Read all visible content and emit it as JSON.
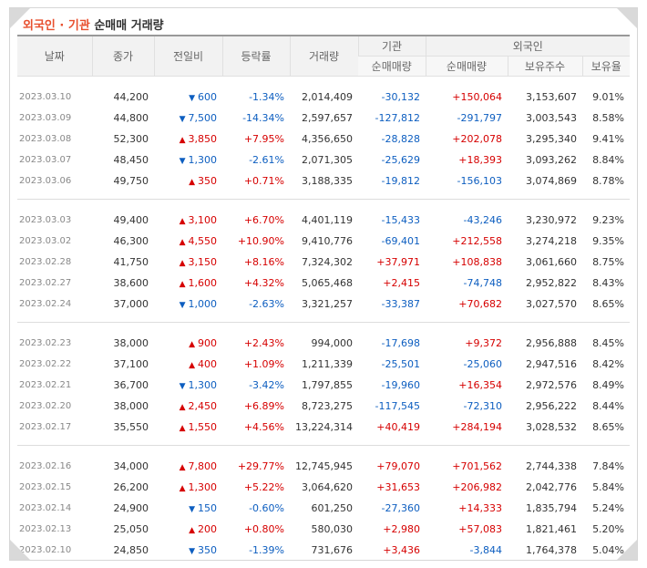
{
  "title": {
    "part1": "외국인 · 기관",
    "part2": "순매매 거래량"
  },
  "headers": {
    "date": "날짜",
    "close": "종가",
    "change": "전일비",
    "rate": "등락률",
    "volume": "거래량",
    "inst": "기관",
    "foreign": "외국인",
    "inst_net": "순매매량",
    "foreign_net": "순매매량",
    "foreign_hold": "보유주수",
    "foreign_ratio": "보유율"
  },
  "groups": [
    [
      {
        "date": "2023.03.10",
        "close": "44,200",
        "dir": "down",
        "change": "600",
        "rate": "-1.34%",
        "volume": "2,014,409",
        "inst": "-30,132",
        "foreign": "+150,064",
        "hold": "3,153,607",
        "ratio": "9.01%"
      },
      {
        "date": "2023.03.09",
        "close": "44,800",
        "dir": "down",
        "change": "7,500",
        "rate": "-14.34%",
        "volume": "2,597,657",
        "inst": "-127,812",
        "foreign": "-291,797",
        "hold": "3,003,543",
        "ratio": "8.58%"
      },
      {
        "date": "2023.03.08",
        "close": "52,300",
        "dir": "up",
        "change": "3,850",
        "rate": "+7.95%",
        "volume": "4,356,650",
        "inst": "-28,828",
        "foreign": "+202,078",
        "hold": "3,295,340",
        "ratio": "9.41%"
      },
      {
        "date": "2023.03.07",
        "close": "48,450",
        "dir": "down",
        "change": "1,300",
        "rate": "-2.61%",
        "volume": "2,071,305",
        "inst": "-25,629",
        "foreign": "+18,393",
        "hold": "3,093,262",
        "ratio": "8.84%"
      },
      {
        "date": "2023.03.06",
        "close": "49,750",
        "dir": "up",
        "change": "350",
        "rate": "+0.71%",
        "volume": "3,188,335",
        "inst": "-19,812",
        "foreign": "-156,103",
        "hold": "3,074,869",
        "ratio": "8.78%"
      }
    ],
    [
      {
        "date": "2023.03.03",
        "close": "49,400",
        "dir": "up",
        "change": "3,100",
        "rate": "+6.70%",
        "volume": "4,401,119",
        "inst": "-15,433",
        "foreign": "-43,246",
        "hold": "3,230,972",
        "ratio": "9.23%"
      },
      {
        "date": "2023.03.02",
        "close": "46,300",
        "dir": "up",
        "change": "4,550",
        "rate": "+10.90%",
        "volume": "9,410,776",
        "inst": "-69,401",
        "foreign": "+212,558",
        "hold": "3,274,218",
        "ratio": "9.35%"
      },
      {
        "date": "2023.02.28",
        "close": "41,750",
        "dir": "up",
        "change": "3,150",
        "rate": "+8.16%",
        "volume": "7,324,302",
        "inst": "+37,971",
        "foreign": "+108,838",
        "hold": "3,061,660",
        "ratio": "8.75%"
      },
      {
        "date": "2023.02.27",
        "close": "38,600",
        "dir": "up",
        "change": "1,600",
        "rate": "+4.32%",
        "volume": "5,065,468",
        "inst": "+2,415",
        "foreign": "-74,748",
        "hold": "2,952,822",
        "ratio": "8.43%"
      },
      {
        "date": "2023.02.24",
        "close": "37,000",
        "dir": "down",
        "change": "1,000",
        "rate": "-2.63%",
        "volume": "3,321,257",
        "inst": "-33,387",
        "foreign": "+70,682",
        "hold": "3,027,570",
        "ratio": "8.65%"
      }
    ],
    [
      {
        "date": "2023.02.23",
        "close": "38,000",
        "dir": "up",
        "change": "900",
        "rate": "+2.43%",
        "volume": "994,000",
        "inst": "-17,698",
        "foreign": "+9,372",
        "hold": "2,956,888",
        "ratio": "8.45%"
      },
      {
        "date": "2023.02.22",
        "close": "37,100",
        "dir": "up",
        "change": "400",
        "rate": "+1.09%",
        "volume": "1,211,339",
        "inst": "-25,501",
        "foreign": "-25,060",
        "hold": "2,947,516",
        "ratio": "8.42%"
      },
      {
        "date": "2023.02.21",
        "close": "36,700",
        "dir": "down",
        "change": "1,300",
        "rate": "-3.42%",
        "volume": "1,797,855",
        "inst": "-19,960",
        "foreign": "+16,354",
        "hold": "2,972,576",
        "ratio": "8.49%"
      },
      {
        "date": "2023.02.20",
        "close": "38,000",
        "dir": "up",
        "change": "2,450",
        "rate": "+6.89%",
        "volume": "8,723,275",
        "inst": "-117,545",
        "foreign": "-72,310",
        "hold": "2,956,222",
        "ratio": "8.44%"
      },
      {
        "date": "2023.02.17",
        "close": "35,550",
        "dir": "up",
        "change": "1,550",
        "rate": "+4.56%",
        "volume": "13,224,314",
        "inst": "+40,419",
        "foreign": "+284,194",
        "hold": "3,028,532",
        "ratio": "8.65%"
      }
    ],
    [
      {
        "date": "2023.02.16",
        "close": "34,000",
        "dir": "up",
        "change": "7,800",
        "rate": "+29.77%",
        "volume": "12,745,945",
        "inst": "+79,070",
        "foreign": "+701,562",
        "hold": "2,744,338",
        "ratio": "7.84%"
      },
      {
        "date": "2023.02.15",
        "close": "26,200",
        "dir": "up",
        "change": "1,300",
        "rate": "+5.22%",
        "volume": "3,064,620",
        "inst": "+31,653",
        "foreign": "+206,982",
        "hold": "2,042,776",
        "ratio": "5.84%"
      },
      {
        "date": "2023.02.14",
        "close": "24,900",
        "dir": "down",
        "change": "150",
        "rate": "-0.60%",
        "volume": "601,250",
        "inst": "-27,360",
        "foreign": "+14,333",
        "hold": "1,835,794",
        "ratio": "5.24%"
      },
      {
        "date": "2023.02.13",
        "close": "25,050",
        "dir": "up",
        "change": "200",
        "rate": "+0.80%",
        "volume": "580,030",
        "inst": "+2,980",
        "foreign": "+57,083",
        "hold": "1,821,461",
        "ratio": "5.20%"
      },
      {
        "date": "2023.02.10",
        "close": "24,850",
        "dir": "down",
        "change": "350",
        "rate": "-1.39%",
        "volume": "731,676",
        "inst": "+3,436",
        "foreign": "-3,844",
        "hold": "1,764,378",
        "ratio": "5.04%"
      }
    ]
  ],
  "colors": {
    "up": "#d60000",
    "down": "#0d5ec0",
    "title_accent": "#e8502f"
  },
  "icons": {
    "up": "triangle-up-icon",
    "down": "triangle-down-icon"
  }
}
